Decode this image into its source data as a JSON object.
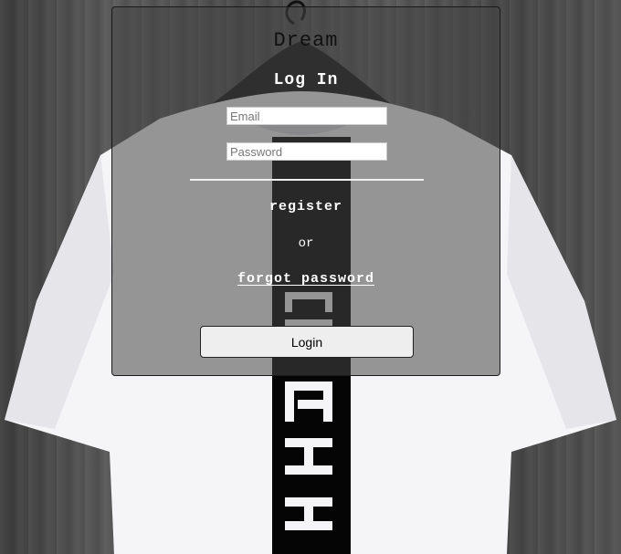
{
  "brand": "Dream",
  "heading": "Log In",
  "form": {
    "email_placeholder": "Email",
    "email_value": "",
    "password_placeholder": "Password",
    "password_value": ""
  },
  "links": {
    "register": "register",
    "or": "or",
    "forgot_password": "forgot password"
  },
  "login_label": "Login",
  "background": {
    "description_icon": "t-shirt-on-hanger-photo"
  }
}
